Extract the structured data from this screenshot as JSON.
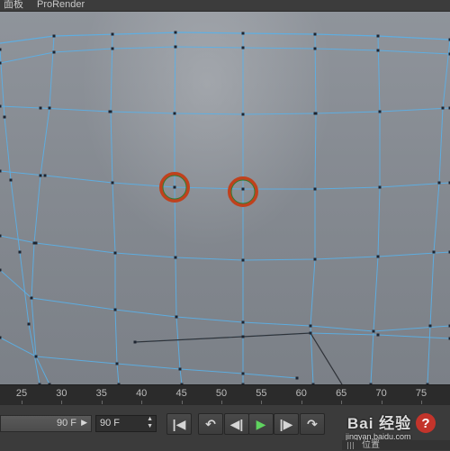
{
  "menubar": {
    "item1": "面板",
    "item2": "ProRender"
  },
  "viewport": {
    "mesh_color": "#8a8f96",
    "wire_color": "#5ab0e8",
    "highlight_ring_color": "#c0411d",
    "highlighted_points": 2
  },
  "timeline": {
    "ticks": [
      "25",
      "30",
      "35",
      "40",
      "45",
      "50",
      "55",
      "60",
      "65",
      "70",
      "75"
    ]
  },
  "transport": {
    "start_frame_value": "90 F",
    "end_frame_value": "90 F",
    "buttons": {
      "go_start": "|◀",
      "prev_key": "↶",
      "step_back": "◀|",
      "play": "▶",
      "step_fwd": "|▶",
      "next_key": "↷"
    }
  },
  "help_label": "?",
  "watermark": {
    "brand": "Bai 经验",
    "url": "jingyan.baidu.com"
  },
  "panel": {
    "label": "位置"
  }
}
